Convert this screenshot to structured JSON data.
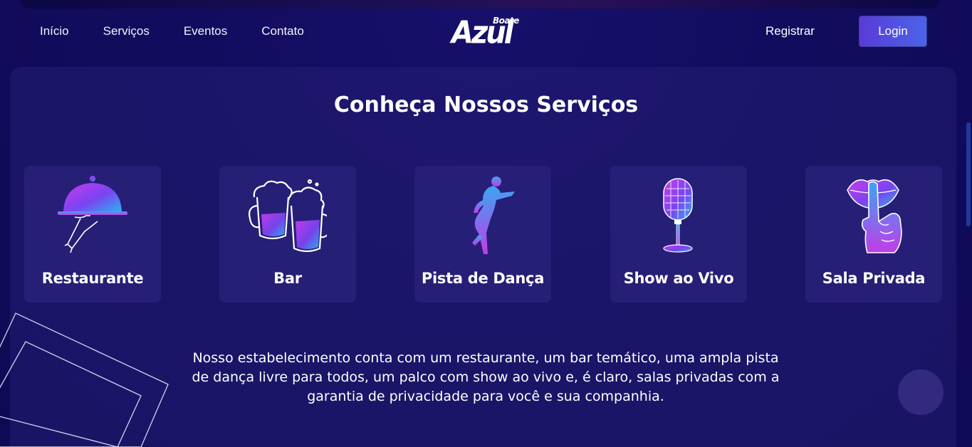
{
  "nav": {
    "links": [
      "Início",
      "Serviços",
      "Eventos",
      "Contato"
    ],
    "logo": {
      "main": "Azul",
      "small": "Boate"
    },
    "register_label": "Registrar",
    "login_label": "Login"
  },
  "services": {
    "title": "Conheça Nossos Serviços",
    "cards": [
      {
        "label": "Restaurante",
        "icon": "cloche-icon"
      },
      {
        "label": "Bar",
        "icon": "beer-mugs-icon"
      },
      {
        "label": "Pista de Dança",
        "icon": "dancer-icon"
      },
      {
        "label": "Show ao Vivo",
        "icon": "microphone-icon"
      },
      {
        "label": "Sala Privada",
        "icon": "shush-lips-icon"
      }
    ],
    "description": "Nosso estabelecimento conta com um restaurante, um bar temático, uma ampla pista de dança livre para todos, um palco com show ao vivo e, é claro, salas privadas com a garantia de privacidade para você e sua companhia."
  },
  "colors": {
    "background": "#100b58",
    "accent_purple": "#b43cf0",
    "accent_blue": "#3aa0f0",
    "login_button": "#5a3bd8"
  }
}
